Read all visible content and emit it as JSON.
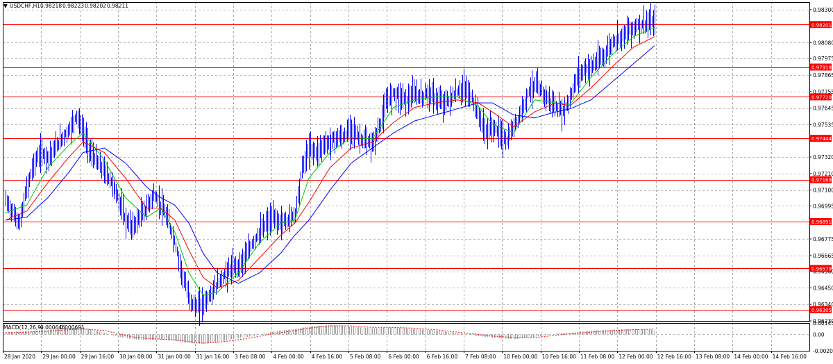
{
  "symbol_info": {
    "symbol": "USDCHF,H1",
    "open": "0.98218",
    "high": "0.98223",
    "low": "0.98202",
    "close": "0.98211"
  },
  "macd_info": {
    "label": "MACD(12,26,9)",
    "main": "0.000646",
    "signal": "0.000691"
  },
  "colors": {
    "background": "#ffffff",
    "candles": "#0000ff",
    "horizontal_level": "#ff0000",
    "ma_fast": "#00cc00",
    "ma_mid": "#ff0000",
    "ma_slow": "#0000ff",
    "macd_histogram": "#a0a0a0",
    "macd_signal": "#ff0000"
  },
  "price_axis": {
    "labels": [
      "0.98300",
      "0.98080",
      "0.97975",
      "0.97865",
      "0.97755",
      "0.97645",
      "0.97535",
      "0.97320",
      "0.97210",
      "0.97100",
      "0.96995",
      "0.96775",
      "0.96665",
      "0.96560",
      "0.96450",
      "0.96340",
      "0.96230"
    ],
    "tags": [
      "0.98201",
      "0.97918",
      "0.97720",
      "0.97444",
      "0.97169",
      "0.96891",
      "0.96579",
      "0.96305"
    ]
  },
  "macd_axis": {
    "labels": [
      "0.001458",
      "0.00",
      "-0.002078"
    ]
  },
  "time_axis": {
    "labels": [
      "28 Jan 2020",
      "29 Jan 00:00",
      "29 Jan 16:00",
      "30 Jan 08:00",
      "31 Jan 00:00",
      "31 Jan 16:00",
      "3 Feb 08:00",
      "4 Feb 00:00",
      "4 Feb 16:00",
      "5 Feb 08:00",
      "6 Feb 00:00",
      "6 Feb 16:00",
      "7 Feb 08:00",
      "10 Feb 00:00",
      "10 Feb 16:00",
      "11 Feb 08:00",
      "12 Feb 00:00",
      "12 Feb 16:00",
      "13 Feb 08:00",
      "14 Feb 00:00",
      "14 Feb 16:00"
    ]
  },
  "chart_data": {
    "type": "line",
    "subtype": "candlestick-price-chart",
    "symbol": "USDCHF",
    "timeframe": "H1",
    "ylim": [
      0.9623,
      0.9835
    ],
    "horizontal_levels": [
      0.98201,
      0.97918,
      0.9772,
      0.97444,
      0.97169,
      0.96891,
      0.96579,
      0.96305
    ],
    "close_path": [
      [
        0,
        0.9703
      ],
      [
        2,
        0.9695
      ],
      [
        4,
        0.9688
      ],
      [
        6,
        0.9712
      ],
      [
        8,
        0.9728
      ],
      [
        10,
        0.9735
      ],
      [
        12,
        0.9732
      ],
      [
        14,
        0.9738
      ],
      [
        16,
        0.9745
      ],
      [
        18,
        0.975
      ],
      [
        20,
        0.976
      ],
      [
        22,
        0.9748
      ],
      [
        24,
        0.9735
      ],
      [
        26,
        0.9728
      ],
      [
        28,
        0.9722
      ],
      [
        30,
        0.9715
      ],
      [
        32,
        0.9705
      ],
      [
        34,
        0.969
      ],
      [
        36,
        0.9685
      ],
      [
        38,
        0.9692
      ],
      [
        40,
        0.9698
      ],
      [
        42,
        0.9707
      ],
      [
        44,
        0.97
      ],
      [
        46,
        0.969
      ],
      [
        48,
        0.9675
      ],
      [
        50,
        0.9655
      ],
      [
        52,
        0.9638
      ],
      [
        54,
        0.9632
      ],
      [
        56,
        0.9635
      ],
      [
        58,
        0.964
      ],
      [
        60,
        0.9648
      ],
      [
        62,
        0.9653
      ],
      [
        64,
        0.9658
      ],
      [
        66,
        0.966
      ],
      [
        68,
        0.9665
      ],
      [
        70,
        0.9675
      ],
      [
        72,
        0.9682
      ],
      [
        74,
        0.9688
      ],
      [
        76,
        0.9692
      ],
      [
        78,
        0.9688
      ],
      [
        80,
        0.969
      ],
      [
        82,
        0.9695
      ],
      [
        84,
        0.9725
      ],
      [
        86,
        0.9738
      ],
      [
        88,
        0.9735
      ],
      [
        90,
        0.974
      ],
      [
        92,
        0.9742
      ],
      [
        94,
        0.9745
      ],
      [
        96,
        0.9745
      ],
      [
        98,
        0.9752
      ],
      [
        100,
        0.9745
      ],
      [
        102,
        0.9742
      ],
      [
        104,
        0.974
      ],
      [
        106,
        0.9752
      ],
      [
        108,
        0.9768
      ],
      [
        110,
        0.9775
      ],
      [
        112,
        0.9772
      ],
      [
        114,
        0.977
      ],
      [
        116,
        0.9774
      ],
      [
        118,
        0.9772
      ],
      [
        120,
        0.9775
      ],
      [
        122,
        0.977
      ],
      [
        124,
        0.9768
      ],
      [
        126,
        0.977
      ],
      [
        128,
        0.9775
      ],
      [
        130,
        0.9778
      ],
      [
        132,
        0.9772
      ],
      [
        134,
        0.976
      ],
      [
        136,
        0.9748
      ],
      [
        138,
        0.9752
      ],
      [
        140,
        0.9748
      ],
      [
        142,
        0.9742
      ],
      [
        144,
        0.9752
      ],
      [
        146,
        0.9762
      ],
      [
        148,
        0.9775
      ],
      [
        150,
        0.978
      ],
      [
        152,
        0.9775
      ],
      [
        154,
        0.977
      ],
      [
        156,
        0.9765
      ],
      [
        158,
        0.9762
      ],
      [
        160,
        0.977
      ],
      [
        162,
        0.9785
      ],
      [
        164,
        0.979
      ],
      [
        166,
        0.9792
      ],
      [
        168,
        0.9796
      ],
      [
        170,
        0.98
      ],
      [
        172,
        0.9808
      ],
      [
        174,
        0.9812
      ],
      [
        176,
        0.9815
      ],
      [
        178,
        0.9818
      ],
      [
        180,
        0.982
      ],
      [
        182,
        0.9821
      ],
      [
        184,
        0.9821
      ]
    ],
    "ma_fast": [
      [
        0,
        0.9695
      ],
      [
        6,
        0.97
      ],
      [
        12,
        0.9725
      ],
      [
        18,
        0.974
      ],
      [
        22,
        0.9748
      ],
      [
        28,
        0.973
      ],
      [
        34,
        0.9705
      ],
      [
        40,
        0.9692
      ],
      [
        44,
        0.9698
      ],
      [
        48,
        0.9682
      ],
      [
        52,
        0.9655
      ],
      [
        56,
        0.964
      ],
      [
        60,
        0.9642
      ],
      [
        66,
        0.9655
      ],
      [
        72,
        0.9675
      ],
      [
        78,
        0.9688
      ],
      [
        82,
        0.969
      ],
      [
        86,
        0.9718
      ],
      [
        92,
        0.9735
      ],
      [
        98,
        0.9745
      ],
      [
        104,
        0.9744
      ],
      [
        110,
        0.9765
      ],
      [
        116,
        0.977
      ],
      [
        122,
        0.9772
      ],
      [
        128,
        0.9772
      ],
      [
        134,
        0.9766
      ],
      [
        138,
        0.9754
      ],
      [
        144,
        0.9748
      ],
      [
        150,
        0.977
      ],
      [
        156,
        0.9768
      ],
      [
        160,
        0.9767
      ],
      [
        166,
        0.9785
      ],
      [
        172,
        0.98
      ],
      [
        178,
        0.9812
      ],
      [
        184,
        0.9818
      ]
    ],
    "ma_mid": [
      [
        0,
        0.969
      ],
      [
        6,
        0.9696
      ],
      [
        12,
        0.9715
      ],
      [
        18,
        0.9732
      ],
      [
        22,
        0.9742
      ],
      [
        28,
        0.9735
      ],
      [
        34,
        0.9718
      ],
      [
        40,
        0.9698
      ],
      [
        44,
        0.9698
      ],
      [
        48,
        0.969
      ],
      [
        52,
        0.967
      ],
      [
        56,
        0.9652
      ],
      [
        60,
        0.9645
      ],
      [
        66,
        0.965
      ],
      [
        72,
        0.9665
      ],
      [
        78,
        0.968
      ],
      [
        82,
        0.9688
      ],
      [
        86,
        0.9702
      ],
      [
        92,
        0.9725
      ],
      [
        98,
        0.9738
      ],
      [
        104,
        0.9742
      ],
      [
        110,
        0.9755
      ],
      [
        116,
        0.9765
      ],
      [
        122,
        0.9768
      ],
      [
        128,
        0.977
      ],
      [
        134,
        0.9768
      ],
      [
        138,
        0.9762
      ],
      [
        144,
        0.9752
      ],
      [
        150,
        0.9762
      ],
      [
        156,
        0.9768
      ],
      [
        160,
        0.9766
      ],
      [
        166,
        0.9778
      ],
      [
        172,
        0.9792
      ],
      [
        178,
        0.9805
      ],
      [
        184,
        0.9812
      ]
    ],
    "ma_slow": [
      [
        0,
        0.969
      ],
      [
        6,
        0.9692
      ],
      [
        12,
        0.9705
      ],
      [
        18,
        0.9722
      ],
      [
        22,
        0.9735
      ],
      [
        28,
        0.9738
      ],
      [
        34,
        0.9728
      ],
      [
        40,
        0.9712
      ],
      [
        44,
        0.9705
      ],
      [
        48,
        0.97
      ],
      [
        52,
        0.9688
      ],
      [
        56,
        0.9668
      ],
      [
        60,
        0.9655
      ],
      [
        66,
        0.9648
      ],
      [
        72,
        0.9655
      ],
      [
        78,
        0.9668
      ],
      [
        82,
        0.968
      ],
      [
        86,
        0.969
      ],
      [
        92,
        0.971
      ],
      [
        98,
        0.9728
      ],
      [
        104,
        0.9738
      ],
      [
        110,
        0.9748
      ],
      [
        116,
        0.9756
      ],
      [
        122,
        0.976
      ],
      [
        128,
        0.9764
      ],
      [
        134,
        0.9768
      ],
      [
        138,
        0.9768
      ],
      [
        144,
        0.976
      ],
      [
        150,
        0.9758
      ],
      [
        156,
        0.9762
      ],
      [
        160,
        0.9764
      ],
      [
        166,
        0.977
      ],
      [
        172,
        0.9782
      ],
      [
        178,
        0.9794
      ],
      [
        184,
        0.9806
      ]
    ],
    "macd_histogram": [
      [
        0,
        0.0003
      ],
      [
        6,
        0.0004
      ],
      [
        12,
        0.0006
      ],
      [
        18,
        0.0008
      ],
      [
        22,
        0.0009
      ],
      [
        28,
        0.0002
      ],
      [
        32,
        -0.0003
      ],
      [
        36,
        -0.0006
      ],
      [
        40,
        -0.0007
      ],
      [
        44,
        -0.0006
      ],
      [
        48,
        -0.0008
      ],
      [
        52,
        -0.0011
      ],
      [
        56,
        -0.0012
      ],
      [
        60,
        -0.001
      ],
      [
        64,
        -0.0006
      ],
      [
        70,
        -0.0002
      ],
      [
        76,
        0.0004
      ],
      [
        82,
        0.0007
      ],
      [
        86,
        0.001
      ],
      [
        92,
        0.0012
      ],
      [
        98,
        0.001
      ],
      [
        104,
        0.0008
      ],
      [
        110,
        0.0009
      ],
      [
        116,
        0.0007
      ],
      [
        122,
        0.0005
      ],
      [
        128,
        0.0002
      ],
      [
        134,
        -0.0002
      ],
      [
        138,
        -0.0004
      ],
      [
        144,
        -0.0006
      ],
      [
        150,
        -0.0003
      ],
      [
        156,
        0.0001
      ],
      [
        160,
        0.0002
      ],
      [
        166,
        0.0005
      ],
      [
        172,
        0.0006
      ],
      [
        178,
        0.0007
      ],
      [
        184,
        0.0006
      ]
    ],
    "macd_signal": [
      [
        0,
        0.0002
      ],
      [
        6,
        0.0003
      ],
      [
        12,
        0.0004
      ],
      [
        18,
        0.0006
      ],
      [
        22,
        0.0007
      ],
      [
        28,
        0.0005
      ],
      [
        32,
        0.0001
      ],
      [
        36,
        -0.0003
      ],
      [
        40,
        -0.0005
      ],
      [
        44,
        -0.0006
      ],
      [
        48,
        -0.0007
      ],
      [
        52,
        -0.0009
      ],
      [
        56,
        -0.0011
      ],
      [
        60,
        -0.001
      ],
      [
        64,
        -0.0008
      ],
      [
        70,
        -0.0004
      ],
      [
        76,
        0.0001
      ],
      [
        82,
        0.0005
      ],
      [
        86,
        0.0008
      ],
      [
        92,
        0.0011
      ],
      [
        98,
        0.0011
      ],
      [
        104,
        0.0009
      ],
      [
        110,
        0.0009
      ],
      [
        116,
        0.0008
      ],
      [
        122,
        0.0006
      ],
      [
        128,
        0.0003
      ],
      [
        134,
        0.0
      ],
      [
        138,
        -0.0002
      ],
      [
        144,
        -0.0004
      ],
      [
        150,
        -0.0004
      ],
      [
        156,
        -0.0001
      ],
      [
        160,
        0.0001
      ],
      [
        166,
        0.0003
      ],
      [
        172,
        0.0005
      ],
      [
        178,
        0.0006
      ],
      [
        184,
        0.0007
      ]
    ],
    "macd_ylim": [
      -0.002078,
      0.001458
    ]
  }
}
